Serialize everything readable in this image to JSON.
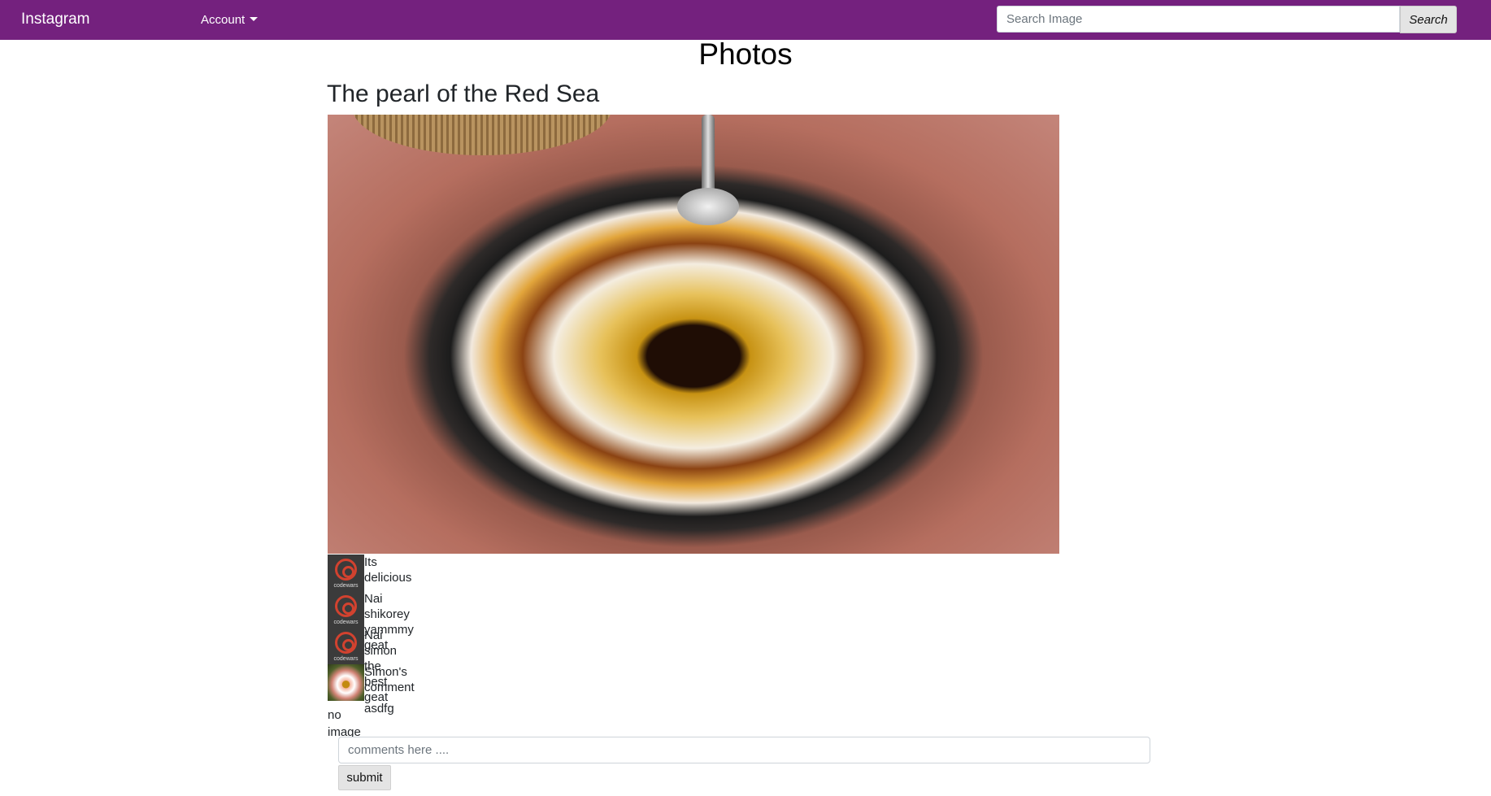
{
  "navbar": {
    "brand": "Instagram",
    "account_label": "Account",
    "search_placeholder": "Search Image",
    "search_button": "Search",
    "background_color": "#74217e"
  },
  "page": {
    "title": "Photos"
  },
  "post": {
    "title": "The pearl of the Red Sea",
    "comments": [
      {
        "avatar": "codewars-logo",
        "avatar_text": "codewars",
        "text": "Its delicious"
      },
      {
        "avatar": "codewars-logo",
        "avatar_text": "codewars",
        "text": "Nai shikorey yammmy geat"
      },
      {
        "avatar": "codewars-logo",
        "avatar_text": "codewars",
        "text": "Nai simon the best geat"
      },
      {
        "avatar": "flower-photo",
        "text": "Simon's comment"
      },
      {
        "avatar": "broken-image",
        "alt": "no image",
        "text": "asdfg"
      }
    ],
    "comment_placeholder": "comments here ....",
    "submit_label": "submit"
  }
}
